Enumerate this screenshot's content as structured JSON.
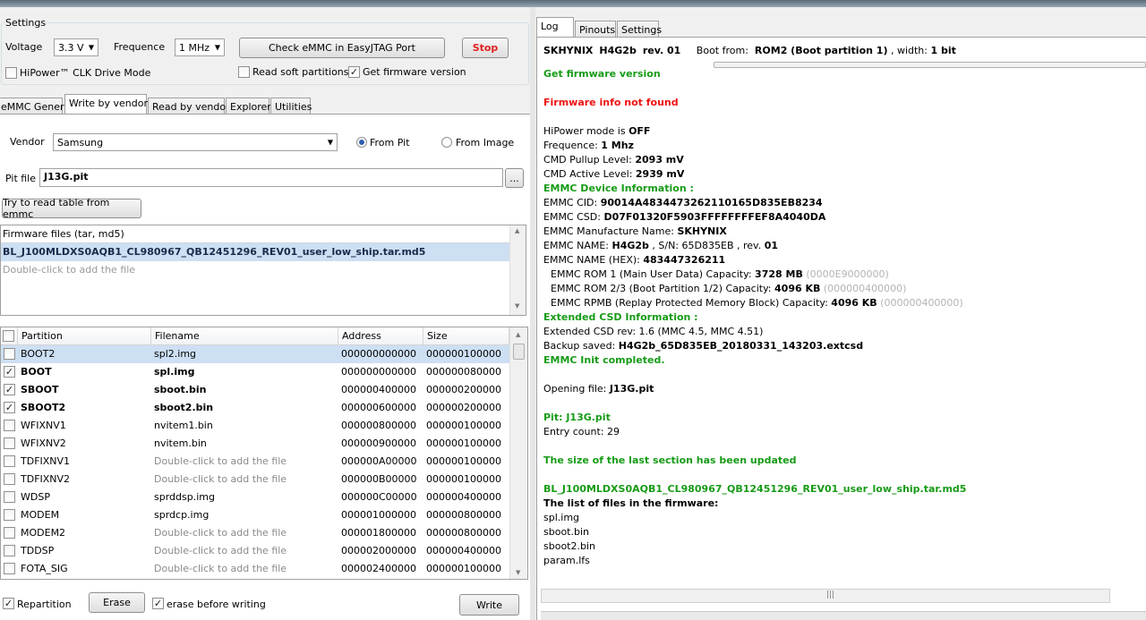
{
  "settings": {
    "group_title": "Settings",
    "voltage_label": "Voltage",
    "voltage_value": "3.3 V",
    "frequence_label": "Frequence",
    "frequence_value": "1 MHz",
    "check_button": "Check eMMC in EasyJTAG Port",
    "stop_button": "Stop",
    "hipower_label": "HiPower™ CLK Drive Mode",
    "hipower_checked": false,
    "read_soft_label": "Read soft partitions",
    "read_soft_checked": false,
    "get_fw_label": "Get firmware version",
    "get_fw_checked": true
  },
  "left_tabs": [
    "eMMC General",
    "Write by vendor",
    "Read by vendor",
    "Explorer",
    "Utilities"
  ],
  "vendor": {
    "label": "Vendor",
    "value": "Samsung",
    "from_pit": "From Pit",
    "from_image": "From Image"
  },
  "pit": {
    "label": "Pit file",
    "value": "J13G.pit",
    "browse": "...",
    "try_button": "Try to read table from emmc"
  },
  "firmware": {
    "header": "Firmware files (tar, md5)",
    "file": "BL_J100MLDXS0AQB1_CL980967_QB12451296_REV01_user_low_ship.tar.md5",
    "hint": "Double-click to add the file"
  },
  "partition_table": {
    "columns": [
      "Partition",
      "Filename",
      "Address",
      "Size"
    ],
    "rows": [
      {
        "name": "BOOT2",
        "file": "spl2.img",
        "address": "000000000000",
        "size": "000000100000",
        "checked": false,
        "bold": false,
        "placeholder": false
      },
      {
        "name": "BOOT",
        "file": "spl.img",
        "address": "000000000000",
        "size": "000000080000",
        "checked": true,
        "bold": true,
        "placeholder": false
      },
      {
        "name": "SBOOT",
        "file": "sboot.bin",
        "address": "000000400000",
        "size": "000000200000",
        "checked": true,
        "bold": true,
        "placeholder": false
      },
      {
        "name": "SBOOT2",
        "file": "sboot2.bin",
        "address": "000000600000",
        "size": "000000200000",
        "checked": true,
        "bold": true,
        "placeholder": false
      },
      {
        "name": "WFIXNV1",
        "file": "nvitem1.bin",
        "address": "000000800000",
        "size": "000000100000",
        "checked": false,
        "bold": false,
        "placeholder": false
      },
      {
        "name": "WFIXNV2",
        "file": "nvitem.bin",
        "address": "000000900000",
        "size": "000000100000",
        "checked": false,
        "bold": false,
        "placeholder": false
      },
      {
        "name": "TDFIXNV1",
        "file": "Double-click to add the file",
        "address": "000000A00000",
        "size": "000000100000",
        "checked": false,
        "bold": false,
        "placeholder": true
      },
      {
        "name": "TDFIXNV2",
        "file": "Double-click to add the file",
        "address": "000000B00000",
        "size": "000000100000",
        "checked": false,
        "bold": false,
        "placeholder": true
      },
      {
        "name": "WDSP",
        "file": "sprddsp.img",
        "address": "000000C00000",
        "size": "000000400000",
        "checked": false,
        "bold": false,
        "placeholder": false
      },
      {
        "name": "MODEM",
        "file": "sprdcp.img",
        "address": "000001000000",
        "size": "000000800000",
        "checked": false,
        "bold": false,
        "placeholder": false
      },
      {
        "name": "MODEM2",
        "file": "Double-click to add the file",
        "address": "000001800000",
        "size": "000000800000",
        "checked": false,
        "bold": false,
        "placeholder": true
      },
      {
        "name": "TDDSP",
        "file": "Double-click to add the file",
        "address": "000002000000",
        "size": "000000400000",
        "checked": false,
        "bold": false,
        "placeholder": true
      },
      {
        "name": "FOTA_SIG",
        "file": "Double-click to add the file",
        "address": "000002400000",
        "size": "000000100000",
        "checked": false,
        "bold": false,
        "placeholder": true
      }
    ]
  },
  "bottom": {
    "repartition_label": "Repartition",
    "repartition_checked": true,
    "erase_button": "Erase",
    "erase_before_label": "erase before writing",
    "erase_before_checked": true,
    "write_button": "Write"
  },
  "right_tabs": [
    "Log",
    "Pinouts",
    "Settings"
  ],
  "device_header": {
    "chip": "SKHYNIX",
    "model": "H4G2b",
    "rev": "rev. 01",
    "boot_label": "Boot from:",
    "boot_value": "ROM2 (Boot partition 1)",
    "width_label": ", width:",
    "width_value": "1 bit"
  },
  "log": [
    {
      "t": "green",
      "text": "Get firmware version"
    },
    {
      "t": "blank"
    },
    {
      "t": "red",
      "text": "Firmware info not found"
    },
    {
      "t": "blank"
    },
    {
      "t": "kv",
      "k": "HiPower mode is ",
      "v": "OFF"
    },
    {
      "t": "kv",
      "k": "Frequence: ",
      "v": "1 Mhz"
    },
    {
      "t": "kv",
      "k": "CMD Pullup Level: ",
      "v": "2093  mV"
    },
    {
      "t": "kv",
      "k": "CMD Active Level: ",
      "v": "2939  mV"
    },
    {
      "t": "green",
      "text": "EMMC Device Information :"
    },
    {
      "t": "kv",
      "k": "EMMC CID: ",
      "v": "90014A4834473262110165D835EB8234"
    },
    {
      "t": "kv",
      "k": "EMMC CSD: ",
      "v": "D07F01320F5903FFFFFFFFEF8A4040DA"
    },
    {
      "t": "kv",
      "k": "EMMC Manufacture Name: ",
      "v": "SKHYNIX"
    },
    {
      "t": "kv3",
      "k": "EMMC NAME: ",
      "v": "H4G2b",
      "m": " , S/N: 65D835EB , rev. ",
      "v2": "01"
    },
    {
      "t": "kv",
      "k": "EMMC NAME (HEX): ",
      "v": "483447326211"
    },
    {
      "t": "cap",
      "k": "EMMC ROM 1 (Main User Data) Capacity: ",
      "v": "3728 MB",
      "g": "(0000E9000000)"
    },
    {
      "t": "cap",
      "k": "EMMC ROM 2/3 (Boot Partition 1/2) Capacity: ",
      "v": "4096 KB",
      "g": "(000000400000)"
    },
    {
      "t": "cap",
      "k": "EMMC RPMB (Replay Protected Memory Block) Capacity: ",
      "v": "4096 KB",
      "g": "(000000400000)"
    },
    {
      "t": "green",
      "text": "Extended CSD Information :"
    },
    {
      "t": "plain",
      "text": "Extended CSD rev: 1.6 (MMC 4.5, MMC 4.51)"
    },
    {
      "t": "kv",
      "k": "Backup saved: ",
      "v": "H4G2b_65D835EB_20180331_143203.extcsd"
    },
    {
      "t": "green",
      "text": "EMMC Init completed."
    },
    {
      "t": "blank"
    },
    {
      "t": "kv",
      "k": "Opening file: ",
      "v": "J13G.pit"
    },
    {
      "t": "blank"
    },
    {
      "t": "green",
      "text": "Pit: J13G.pit"
    },
    {
      "t": "plain",
      "text": "Entry count: 29"
    },
    {
      "t": "blank"
    },
    {
      "t": "green",
      "text": "The size of the last section has been updated"
    },
    {
      "t": "blank"
    },
    {
      "t": "green",
      "text": "BL_J100MLDXS0AQB1_CL980967_QB12451296_REV01_user_low_ship.tar.md5"
    },
    {
      "t": "bold",
      "text": "The list of files in the firmware:"
    },
    {
      "t": "plain",
      "text": "spl.img"
    },
    {
      "t": "plain",
      "text": "sboot.bin"
    },
    {
      "t": "plain",
      "text": "sboot2.bin"
    },
    {
      "t": "plain",
      "text": "param.lfs"
    }
  ],
  "icons": {
    "dropdown": "chevron-down-icon",
    "check": "checkmark-icon"
  },
  "colors": {
    "green": "#179b17",
    "red": "#ee1111",
    "selection": "#cddff3"
  }
}
